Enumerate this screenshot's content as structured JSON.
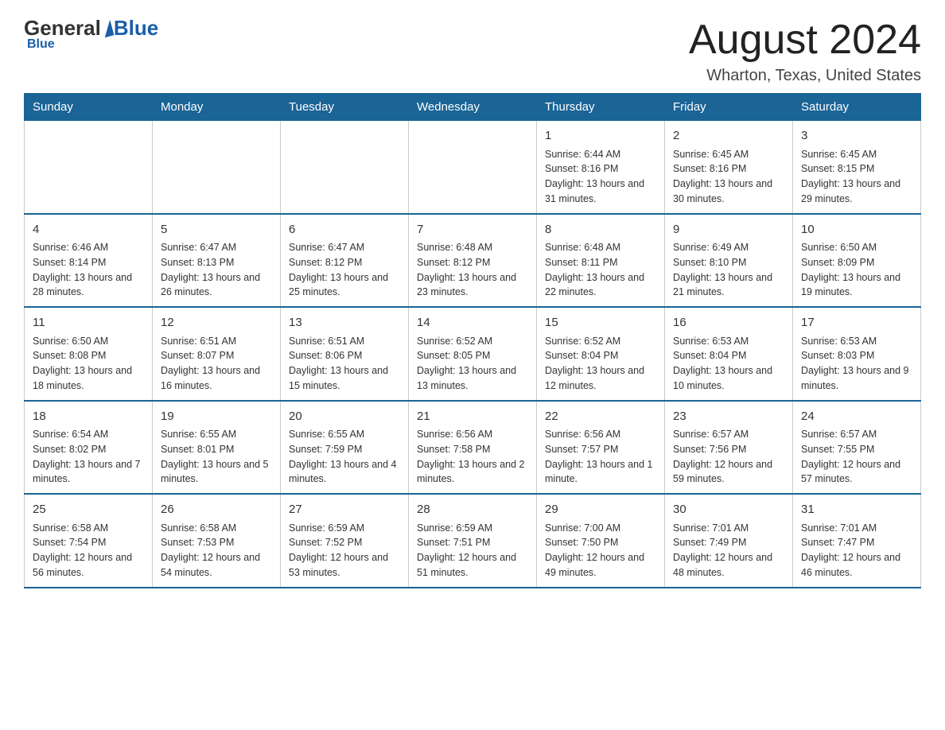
{
  "header": {
    "logo_general": "General",
    "logo_blue": "Blue",
    "month_title": "August 2024",
    "location": "Wharton, Texas, United States"
  },
  "days_of_week": [
    "Sunday",
    "Monday",
    "Tuesday",
    "Wednesday",
    "Thursday",
    "Friday",
    "Saturday"
  ],
  "weeks": [
    [
      {
        "day": "",
        "sunrise": "",
        "sunset": "",
        "daylight": ""
      },
      {
        "day": "",
        "sunrise": "",
        "sunset": "",
        "daylight": ""
      },
      {
        "day": "",
        "sunrise": "",
        "sunset": "",
        "daylight": ""
      },
      {
        "day": "",
        "sunrise": "",
        "sunset": "",
        "daylight": ""
      },
      {
        "day": "1",
        "sunrise": "Sunrise: 6:44 AM",
        "sunset": "Sunset: 8:16 PM",
        "daylight": "Daylight: 13 hours and 31 minutes."
      },
      {
        "day": "2",
        "sunrise": "Sunrise: 6:45 AM",
        "sunset": "Sunset: 8:16 PM",
        "daylight": "Daylight: 13 hours and 30 minutes."
      },
      {
        "day": "3",
        "sunrise": "Sunrise: 6:45 AM",
        "sunset": "Sunset: 8:15 PM",
        "daylight": "Daylight: 13 hours and 29 minutes."
      }
    ],
    [
      {
        "day": "4",
        "sunrise": "Sunrise: 6:46 AM",
        "sunset": "Sunset: 8:14 PM",
        "daylight": "Daylight: 13 hours and 28 minutes."
      },
      {
        "day": "5",
        "sunrise": "Sunrise: 6:47 AM",
        "sunset": "Sunset: 8:13 PM",
        "daylight": "Daylight: 13 hours and 26 minutes."
      },
      {
        "day": "6",
        "sunrise": "Sunrise: 6:47 AM",
        "sunset": "Sunset: 8:12 PM",
        "daylight": "Daylight: 13 hours and 25 minutes."
      },
      {
        "day": "7",
        "sunrise": "Sunrise: 6:48 AM",
        "sunset": "Sunset: 8:12 PM",
        "daylight": "Daylight: 13 hours and 23 minutes."
      },
      {
        "day": "8",
        "sunrise": "Sunrise: 6:48 AM",
        "sunset": "Sunset: 8:11 PM",
        "daylight": "Daylight: 13 hours and 22 minutes."
      },
      {
        "day": "9",
        "sunrise": "Sunrise: 6:49 AM",
        "sunset": "Sunset: 8:10 PM",
        "daylight": "Daylight: 13 hours and 21 minutes."
      },
      {
        "day": "10",
        "sunrise": "Sunrise: 6:50 AM",
        "sunset": "Sunset: 8:09 PM",
        "daylight": "Daylight: 13 hours and 19 minutes."
      }
    ],
    [
      {
        "day": "11",
        "sunrise": "Sunrise: 6:50 AM",
        "sunset": "Sunset: 8:08 PM",
        "daylight": "Daylight: 13 hours and 18 minutes."
      },
      {
        "day": "12",
        "sunrise": "Sunrise: 6:51 AM",
        "sunset": "Sunset: 8:07 PM",
        "daylight": "Daylight: 13 hours and 16 minutes."
      },
      {
        "day": "13",
        "sunrise": "Sunrise: 6:51 AM",
        "sunset": "Sunset: 8:06 PM",
        "daylight": "Daylight: 13 hours and 15 minutes."
      },
      {
        "day": "14",
        "sunrise": "Sunrise: 6:52 AM",
        "sunset": "Sunset: 8:05 PM",
        "daylight": "Daylight: 13 hours and 13 minutes."
      },
      {
        "day": "15",
        "sunrise": "Sunrise: 6:52 AM",
        "sunset": "Sunset: 8:04 PM",
        "daylight": "Daylight: 13 hours and 12 minutes."
      },
      {
        "day": "16",
        "sunrise": "Sunrise: 6:53 AM",
        "sunset": "Sunset: 8:04 PM",
        "daylight": "Daylight: 13 hours and 10 minutes."
      },
      {
        "day": "17",
        "sunrise": "Sunrise: 6:53 AM",
        "sunset": "Sunset: 8:03 PM",
        "daylight": "Daylight: 13 hours and 9 minutes."
      }
    ],
    [
      {
        "day": "18",
        "sunrise": "Sunrise: 6:54 AM",
        "sunset": "Sunset: 8:02 PM",
        "daylight": "Daylight: 13 hours and 7 minutes."
      },
      {
        "day": "19",
        "sunrise": "Sunrise: 6:55 AM",
        "sunset": "Sunset: 8:01 PM",
        "daylight": "Daylight: 13 hours and 5 minutes."
      },
      {
        "day": "20",
        "sunrise": "Sunrise: 6:55 AM",
        "sunset": "Sunset: 7:59 PM",
        "daylight": "Daylight: 13 hours and 4 minutes."
      },
      {
        "day": "21",
        "sunrise": "Sunrise: 6:56 AM",
        "sunset": "Sunset: 7:58 PM",
        "daylight": "Daylight: 13 hours and 2 minutes."
      },
      {
        "day": "22",
        "sunrise": "Sunrise: 6:56 AM",
        "sunset": "Sunset: 7:57 PM",
        "daylight": "Daylight: 13 hours and 1 minute."
      },
      {
        "day": "23",
        "sunrise": "Sunrise: 6:57 AM",
        "sunset": "Sunset: 7:56 PM",
        "daylight": "Daylight: 12 hours and 59 minutes."
      },
      {
        "day": "24",
        "sunrise": "Sunrise: 6:57 AM",
        "sunset": "Sunset: 7:55 PM",
        "daylight": "Daylight: 12 hours and 57 minutes."
      }
    ],
    [
      {
        "day": "25",
        "sunrise": "Sunrise: 6:58 AM",
        "sunset": "Sunset: 7:54 PM",
        "daylight": "Daylight: 12 hours and 56 minutes."
      },
      {
        "day": "26",
        "sunrise": "Sunrise: 6:58 AM",
        "sunset": "Sunset: 7:53 PM",
        "daylight": "Daylight: 12 hours and 54 minutes."
      },
      {
        "day": "27",
        "sunrise": "Sunrise: 6:59 AM",
        "sunset": "Sunset: 7:52 PM",
        "daylight": "Daylight: 12 hours and 53 minutes."
      },
      {
        "day": "28",
        "sunrise": "Sunrise: 6:59 AM",
        "sunset": "Sunset: 7:51 PM",
        "daylight": "Daylight: 12 hours and 51 minutes."
      },
      {
        "day": "29",
        "sunrise": "Sunrise: 7:00 AM",
        "sunset": "Sunset: 7:50 PM",
        "daylight": "Daylight: 12 hours and 49 minutes."
      },
      {
        "day": "30",
        "sunrise": "Sunrise: 7:01 AM",
        "sunset": "Sunset: 7:49 PM",
        "daylight": "Daylight: 12 hours and 48 minutes."
      },
      {
        "day": "31",
        "sunrise": "Sunrise: 7:01 AM",
        "sunset": "Sunset: 7:47 PM",
        "daylight": "Daylight: 12 hours and 46 minutes."
      }
    ]
  ]
}
